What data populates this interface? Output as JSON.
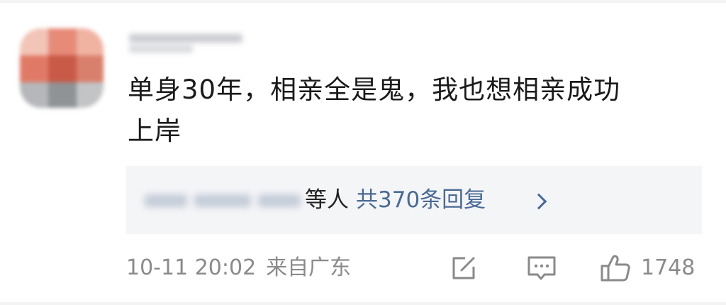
{
  "comment": {
    "text_line1": "单身30年，相亲全是鬼，我也想相亲成功",
    "text_line2": "上岸"
  },
  "replies": {
    "suffix": "等人",
    "link_text": "共370条回复"
  },
  "meta": {
    "timestamp": "10-11 20:02",
    "location": "来自广东"
  },
  "actions": {
    "share_icon": "share-icon",
    "comment_icon": "comment-icon",
    "like_icon": "thumbs-up-icon",
    "like_count": "1748"
  },
  "colors": {
    "link": "#4a6a94",
    "meta": "#8a8a8a",
    "reply_background": "#f4f5f7"
  }
}
